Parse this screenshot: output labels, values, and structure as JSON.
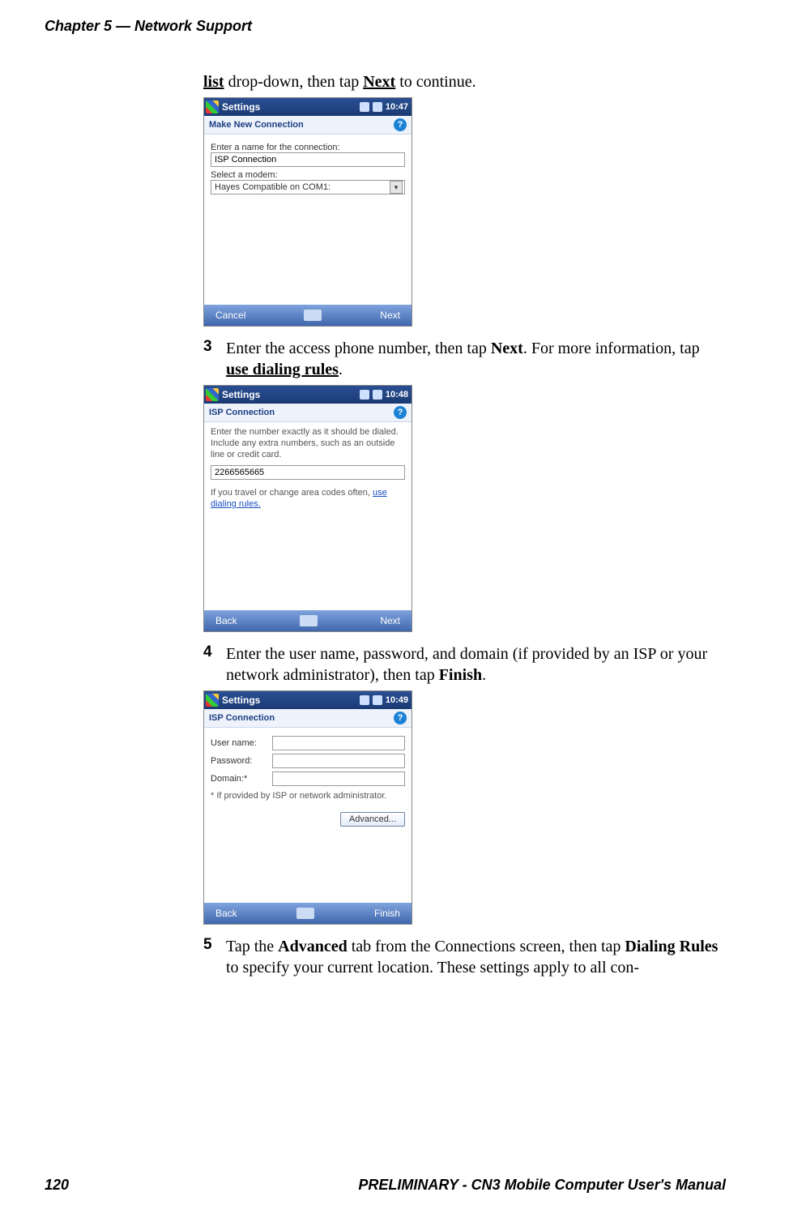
{
  "header": {
    "chapter_title": "Chapter 5 — Network Support"
  },
  "footer": {
    "page_number": "120",
    "right_text": "PRELIMINARY - CN3 Mobile Computer User's Manual"
  },
  "intro": {
    "pre_bold": "list",
    "mid": " drop-down, then tap ",
    "bold2": "Next",
    "post": " to continue."
  },
  "screens": {
    "s1": {
      "title": "Settings",
      "clock": "10:47",
      "section_title": "Make New Connection",
      "label_name": "Enter a name for the connection:",
      "value_name": "ISP Connection",
      "label_modem": "Select a modem:",
      "value_modem": "Hayes Compatible on COM1:",
      "soft_left": "Cancel",
      "soft_right": "Next"
    },
    "s2": {
      "title": "Settings",
      "clock": "10:48",
      "section_title": "ISP Connection",
      "instruction": "Enter the number exactly as it should be dialed.  Include any extra numbers, such as an outside line or credit card.",
      "value_number": "2266565665",
      "hint_pre": "If you travel or change area codes often, ",
      "hint_link": "use dialing rules.",
      "soft_left": "Back",
      "soft_right": "Next"
    },
    "s3": {
      "title": "Settings",
      "clock": "10:49",
      "section_title": "ISP Connection",
      "label_user": "User name:",
      "label_pass": "Password:",
      "label_domain": "Domain:*",
      "footnote": "* If provided by ISP or network administrator.",
      "btn_advanced": "Advanced...",
      "soft_left": "Back",
      "soft_right": "Finish",
      "value_user": "",
      "value_pass": "",
      "value_domain": ""
    }
  },
  "steps": {
    "s3": {
      "num": "3",
      "t1": "Enter the access phone number, then tap ",
      "b1": "Next",
      "t2": ". For more information, tap ",
      "bu1": "use dialing rules",
      "t3": "."
    },
    "s4": {
      "num": "4",
      "t1": "Enter the user name, password, and domain (if provided by an ISP or your network administrator), then tap ",
      "b1": "Finish",
      "t2": "."
    },
    "s5": {
      "num": "5",
      "t1": "Tap the ",
      "b1": "Advanced",
      "t2": " tab from the Connections screen, then tap ",
      "b2": "Dialing Rules",
      "t3": " to specify your current location. These settings apply to all con-"
    }
  }
}
